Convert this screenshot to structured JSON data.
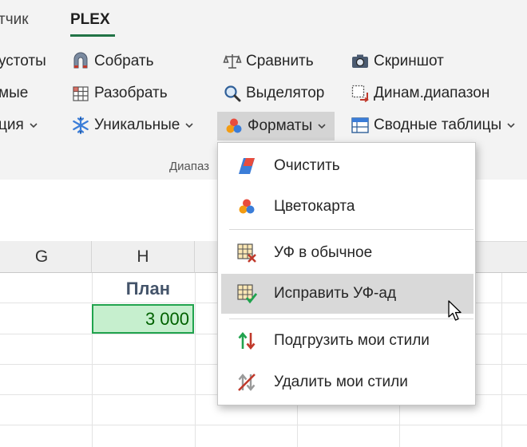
{
  "tabs": [
    {
      "label": "тчик"
    },
    {
      "label": "PLEX",
      "active": true
    }
  ],
  "ribbon": {
    "col0": [
      "устоты",
      "мые",
      "ция"
    ],
    "col1": {
      "collect": "Собрать",
      "split": "Разобрать",
      "unique": "Уникальные"
    },
    "col2": {
      "compare": "Сравнить",
      "highlighter": "Выделятор",
      "formats": "Форматы"
    },
    "col3": {
      "screenshot": "Скриншот",
      "dynrange": "Динам.диапазон",
      "pivot": "Сводные таблицы"
    },
    "group_label": "Диапаз"
  },
  "formats_menu": {
    "items": [
      {
        "label": "Очистить",
        "icon": "eraser-icon"
      },
      {
        "label": "Цветокарта",
        "icon": "color-dots-icon"
      },
      {
        "label": "УФ в обычное",
        "icon": "grid-x-icon"
      },
      {
        "label": "Исправить УФ-ад",
        "icon": "grid-check-icon",
        "highlighted": true
      },
      {
        "label": "Подгрузить мои стили",
        "icon": "arrows-updown-icon"
      },
      {
        "label": "Удалить мои стили",
        "icon": "arrows-strike-icon"
      }
    ]
  },
  "sheet": {
    "columns": [
      "G",
      "H"
    ],
    "header_cell": "План",
    "value_cell": "3 000"
  },
  "colors": {
    "accent": "#217346",
    "cell_fill": "#c6efce",
    "cell_text": "#006100",
    "menu_highlight": "#d9d9d9"
  }
}
